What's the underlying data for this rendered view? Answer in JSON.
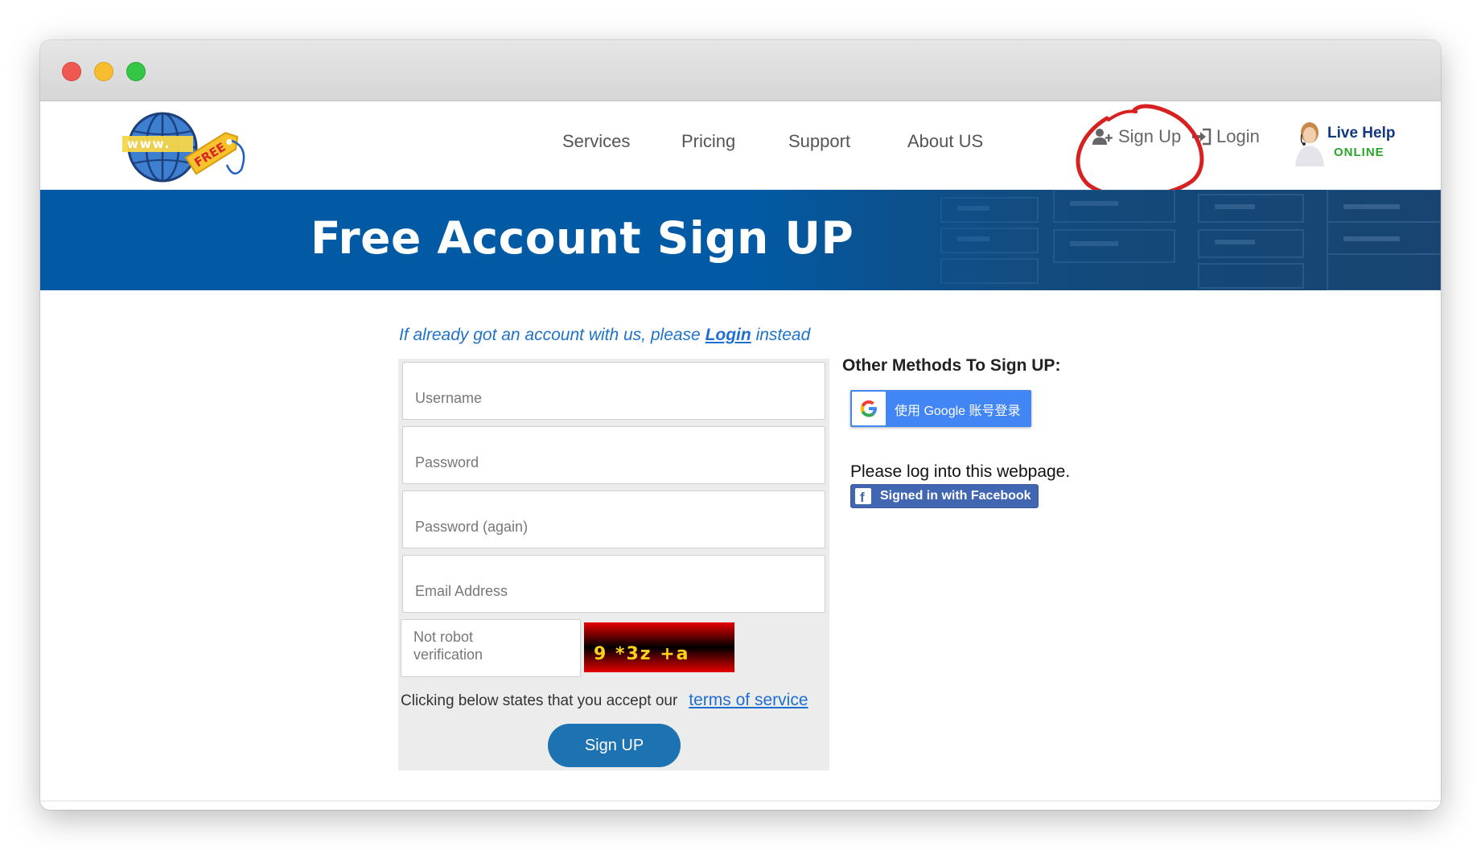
{
  "nav": {
    "links": [
      {
        "label": "Services"
      },
      {
        "label": "Pricing"
      },
      {
        "label": "Support"
      },
      {
        "label": "About US"
      }
    ],
    "signup_label": "Sign Up",
    "login_label": "Login",
    "live_help": {
      "title": "Live Help",
      "status": "ONLINE"
    }
  },
  "logo": {
    "text_www": "www.",
    "tag_text": "FREE"
  },
  "hero": {
    "title": "Free Account Sign UP"
  },
  "prompt": {
    "prefix": "If already got an account with us, please",
    "link": "Login",
    "suffix": "instead"
  },
  "form": {
    "username_placeholder": "Username",
    "password_placeholder": "Password",
    "password_again_placeholder": "Password (again)",
    "email_placeholder": "Email Address",
    "captcha_placeholder": "Not robot verification",
    "captcha_text": "9 *3z +a",
    "tos_text": "Clicking below states that you accept our",
    "tos_link": "terms of service",
    "submit_label": "Sign UP"
  },
  "other": {
    "title": "Other Methods To Sign UP:",
    "google_label": "使用 Google 账号登录",
    "fb_note": "Please log into this webpage.",
    "fb_label": "Signed in with Facebook"
  },
  "colors": {
    "hero_blue": "#025aa5",
    "button_blue": "#1d72b2",
    "google_blue": "#4285f4",
    "facebook_blue": "#4267b2",
    "annotation_red": "#d92020",
    "link_blue": "#1f6fd0"
  }
}
